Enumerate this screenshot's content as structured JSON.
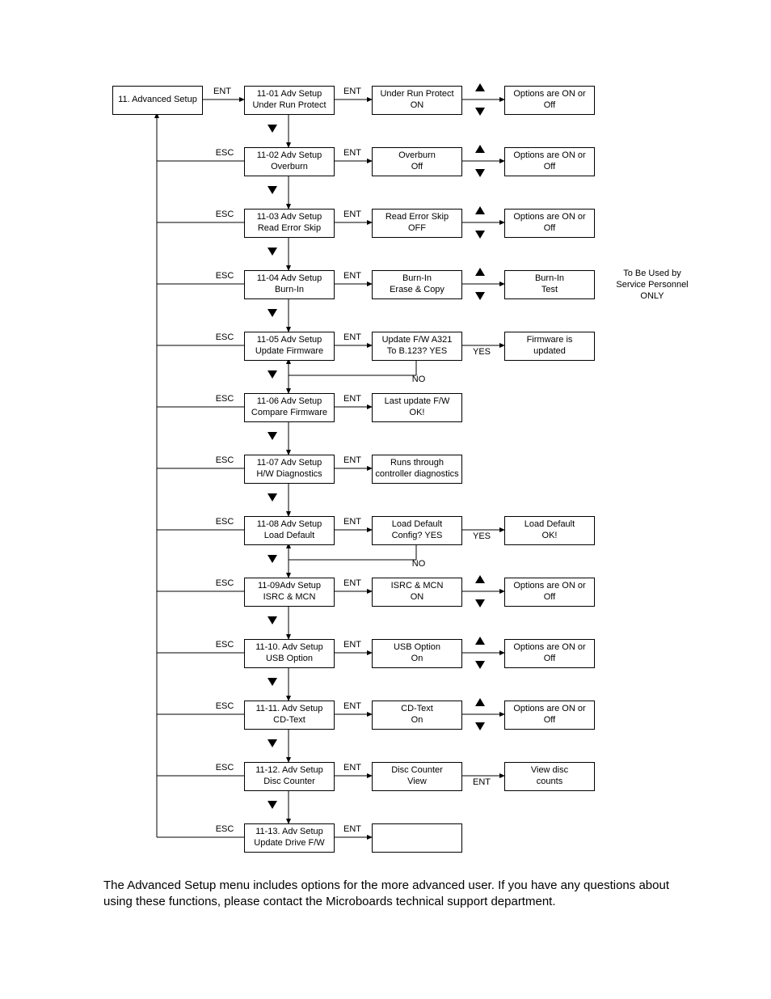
{
  "root": {
    "line1": "11. Advanced Setup"
  },
  "rows": [
    {
      "esc": "",
      "menu1": "11-01 Adv Setup",
      "menu2": "Under Run Protect",
      "ent1": "ENT",
      "state1": "Under Run Protect",
      "state2": "ON",
      "updown": true,
      "mid": "",
      "result1": "Options are ON or",
      "result2": "Off",
      "note1": "",
      "note2": "",
      "note3": ""
    },
    {
      "esc": "ESC",
      "menu1": "11-02 Adv Setup",
      "menu2": "Overburn",
      "ent1": "ENT",
      "state1": "Overburn",
      "state2": "Off",
      "updown": true,
      "mid": "",
      "result1": "Options are ON or",
      "result2": "Off",
      "note1": "",
      "note2": "",
      "note3": ""
    },
    {
      "esc": "ESC",
      "menu1": "11-03 Adv Setup",
      "menu2": "Read Error Skip",
      "ent1": "ENT",
      "state1": "Read Error Skip",
      "state2": "OFF",
      "updown": true,
      "mid": "",
      "result1": "Options are ON or",
      "result2": "Off",
      "note1": "",
      "note2": "",
      "note3": ""
    },
    {
      "esc": "ESC",
      "menu1": "11-04 Adv Setup",
      "menu2": "Burn-In",
      "ent1": "ENT",
      "state1": "Burn-In",
      "state2": "Erase & Copy",
      "updown": true,
      "mid": "",
      "result1": "Burn-In",
      "result2": "Test",
      "note1": "To Be Used by",
      "note2": "Service Personnel",
      "note3": "ONLY"
    },
    {
      "esc": "ESC",
      "menu1": "11-05 Adv Setup",
      "menu2": "Update Firmware",
      "ent1": "ENT",
      "state1": "Update F/W A321",
      "state2": "To B.123?   YES",
      "updown": false,
      "mid": "YES",
      "result1": "Firmware is",
      "result2": "updated",
      "note1": "",
      "note2": "",
      "note3": "",
      "no": "NO"
    },
    {
      "esc": "ESC",
      "menu1": "11-06 Adv Setup",
      "menu2": "Compare Firmware",
      "ent1": "ENT",
      "state1": "Last update F/W",
      "state2": "OK!",
      "updown": false,
      "mid": "",
      "result1": "",
      "result2": "",
      "note1": "",
      "note2": "",
      "note3": ""
    },
    {
      "esc": "ESC",
      "menu1": "11-07 Adv Setup",
      "menu2": "H/W Diagnostics",
      "ent1": "ENT",
      "state1": "Runs through",
      "state2": "controller diagnostics",
      "updown": false,
      "mid": "",
      "result1": "",
      "result2": "",
      "note1": "",
      "note2": "",
      "note3": ""
    },
    {
      "esc": "ESC",
      "menu1": "11-08 Adv Setup",
      "menu2": "Load Default",
      "ent1": "ENT",
      "state1": "Load Default",
      "state2": "Config? YES",
      "updown": false,
      "mid": "YES",
      "result1": "Load Default",
      "result2": "OK!",
      "note1": "",
      "note2": "",
      "note3": "",
      "no": "NO"
    },
    {
      "esc": "ESC",
      "menu1": "11-09Adv Setup",
      "menu2": "ISRC & MCN",
      "ent1": "ENT",
      "state1": "ISRC & MCN",
      "state2": "ON",
      "updown": true,
      "mid": "",
      "result1": "Options are ON or",
      "result2": "Off",
      "note1": "",
      "note2": "",
      "note3": ""
    },
    {
      "esc": "ESC",
      "menu1": "11-10. Adv Setup",
      "menu2": "USB Option",
      "ent1": "ENT",
      "state1": "USB Option",
      "state2": "On",
      "updown": true,
      "mid": "",
      "result1": "Options are ON or",
      "result2": "Off",
      "note1": "",
      "note2": "",
      "note3": ""
    },
    {
      "esc": "ESC",
      "menu1": "11-11. Adv Setup",
      "menu2": "CD-Text",
      "ent1": "ENT",
      "state1": "CD-Text",
      "state2": "On",
      "updown": true,
      "mid": "",
      "result1": "Options are ON or",
      "result2": "Off",
      "note1": "",
      "note2": "",
      "note3": ""
    },
    {
      "esc": "ESC",
      "menu1": "11-12. Adv Setup",
      "menu2": "Disc Counter",
      "ent1": "ENT",
      "state1": "Disc Counter",
      "state2": "View",
      "updown": false,
      "mid": "ENT",
      "result1": "View disc",
      "result2": "counts",
      "note1": "",
      "note2": "",
      "note3": ""
    },
    {
      "esc": "ESC",
      "menu1": "11-13. Adv Setup",
      "menu2": "Update Drive F/W",
      "ent1": "ENT",
      "state1": "",
      "state2": "",
      "updown": false,
      "mid": "",
      "result1": "",
      "result2": "",
      "note1": "",
      "note2": "",
      "note3": ""
    }
  ],
  "ent0": "ENT",
  "paragraph": "The Advanced Setup menu includes options for the more advanced user.  If you have any questions about using these functions, please contact the Microboards technical support department."
}
